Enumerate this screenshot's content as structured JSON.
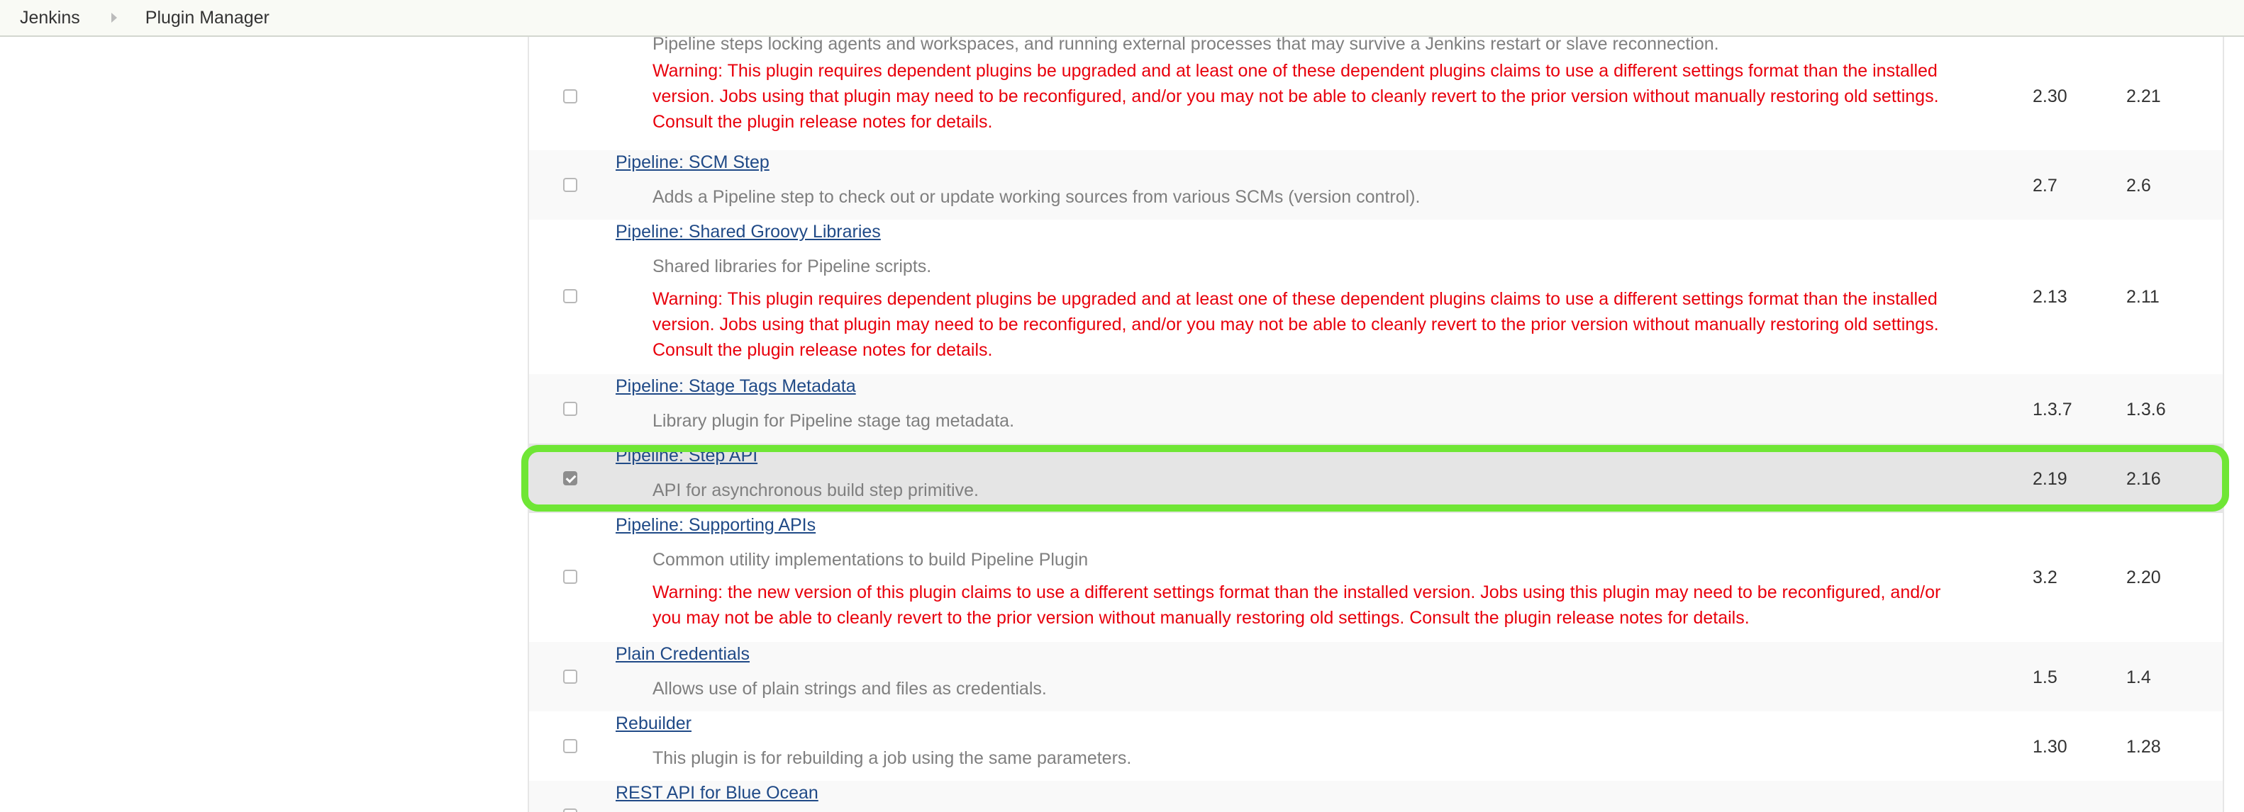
{
  "breadcrumb": {
    "items": [
      "Jenkins",
      "Plugin Manager"
    ]
  },
  "rows": [
    {
      "name": "",
      "description": "Pipeline steps locking agents and workspaces, and running external processes that may survive a Jenkins restart or slave reconnection.",
      "warning": "Warning: This plugin requires dependent plugins be upgraded and at least one of these dependent plugins claims to use a different settings format than the installed\nversion. Jobs using that plugin may need to be reconfigured, and/or you may not be able to cleanly revert to the prior version without manually restoring old settings.\nConsult the plugin release notes for details.",
      "available": "2.30",
      "installed": "2.21",
      "checked": false
    },
    {
      "name": "Pipeline: SCM Step",
      "description": "Adds a Pipeline step to check out or update working sources from various SCMs (version control).",
      "available": "2.7",
      "installed": "2.6",
      "checked": false
    },
    {
      "name": "Pipeline: Shared Groovy Libraries",
      "description": "Shared libraries for Pipeline scripts.",
      "warning": "Warning: This plugin requires dependent plugins be upgraded and at least one of these dependent plugins claims to use a different settings format than the installed\nversion. Jobs using that plugin may need to be reconfigured, and/or you may not be able to cleanly revert to the prior version without manually restoring old settings.\nConsult the plugin release notes for details.",
      "available": "2.13",
      "installed": "2.11",
      "checked": false
    },
    {
      "name": "Pipeline: Stage Tags Metadata",
      "description": "Library plugin for Pipeline stage tag metadata.",
      "available": "1.3.7",
      "installed": "1.3.6",
      "checked": false
    },
    {
      "name": "Pipeline: Step API",
      "description": "API for asynchronous build step primitive.",
      "available": "2.19",
      "installed": "2.16",
      "checked": true
    },
    {
      "name": "Pipeline: Supporting APIs",
      "description": "Common utility implementations to build Pipeline Plugin",
      "warning": "Warning: the new version of this plugin claims to use a different settings format than the installed version. Jobs using this plugin may need to be reconfigured, and/or\nyou may not be able to cleanly revert to the prior version without manually restoring old settings. Consult the plugin release notes for details.",
      "available": "3.2",
      "installed": "2.20",
      "checked": false
    },
    {
      "name": "Plain Credentials",
      "description": "Allows use of plain strings and files as credentials.",
      "available": "1.5",
      "installed": "1.4",
      "checked": false
    },
    {
      "name": "Rebuilder",
      "description": "This plugin is for rebuilding a job using the same parameters.",
      "available": "1.30",
      "installed": "1.28",
      "checked": false
    },
    {
      "name": "REST API for Blue Ocean",
      "description": "",
      "available": "",
      "installed": "",
      "checked": false
    }
  ],
  "colors": {
    "link": "#204a87",
    "warning": "#e8000c",
    "description": "#7f7f7f",
    "highlight": "#6fe635",
    "selected_row": "#e5e5e5"
  }
}
